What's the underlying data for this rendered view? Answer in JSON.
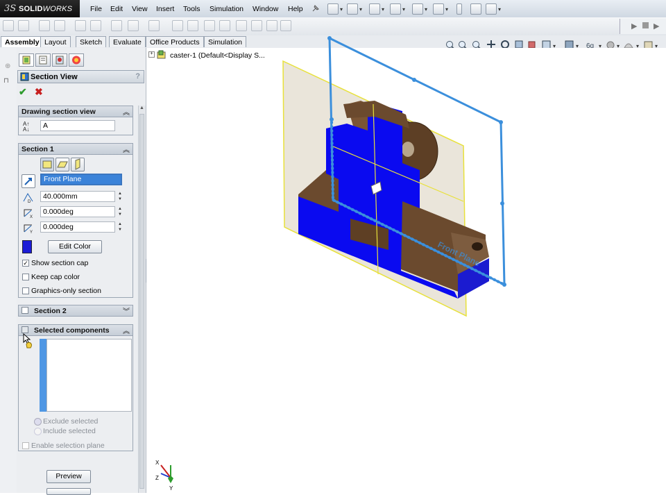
{
  "app": {
    "brand_ds": "3S",
    "brand_name_bold": "SOLID",
    "brand_name_italic": "WORKS"
  },
  "menu": [
    "File",
    "Edit",
    "View",
    "Insert",
    "Tools",
    "Simulation",
    "Window",
    "Help"
  ],
  "tabs": [
    "Assembly",
    "Layout",
    "Sketch",
    "Evaluate",
    "Office Products",
    "Simulation"
  ],
  "active_tab": "Assembly",
  "property_manager": {
    "title": "Section View",
    "help": "?",
    "ok_glyph": "✔",
    "cancel_glyph": "✖",
    "drawing_section_view": {
      "header": "Drawing section view",
      "name_value": "A"
    },
    "section1": {
      "header": "Section 1",
      "reference_value": "Front Plane",
      "offset_value": "40.000mm",
      "rot_x_value": "0.000deg",
      "rot_y_value": "0.000deg",
      "edit_color_label": "Edit Color",
      "cap_color": "#1c1cd6",
      "show_section_cap_label": "Show section cap",
      "show_section_cap_checked": true,
      "keep_cap_color_label": "Keep cap color",
      "keep_cap_color_checked": false,
      "graphics_only_label": "Graphics-only section",
      "graphics_only_checked": false
    },
    "section2": {
      "header": "Section 2"
    },
    "selected_components": {
      "header": "Selected components",
      "exclude_label": "Exclude selected",
      "include_label": "Include selected",
      "enable_plane_label": "Enable selection plane"
    },
    "preview_label": "Preview"
  },
  "feature_tree": {
    "root_label": "caster-1  (Default<Display S..."
  },
  "viewport": {
    "plane_label": "Front Plane",
    "triad": {
      "x": "X",
      "y": "Y",
      "z": "Z"
    }
  },
  "colors": {
    "section_blue": "#0a0af0",
    "plane_blue": "#3b8fdc",
    "plane_yellow": "#e8e13a",
    "part_brown": "#6b4a2e"
  }
}
